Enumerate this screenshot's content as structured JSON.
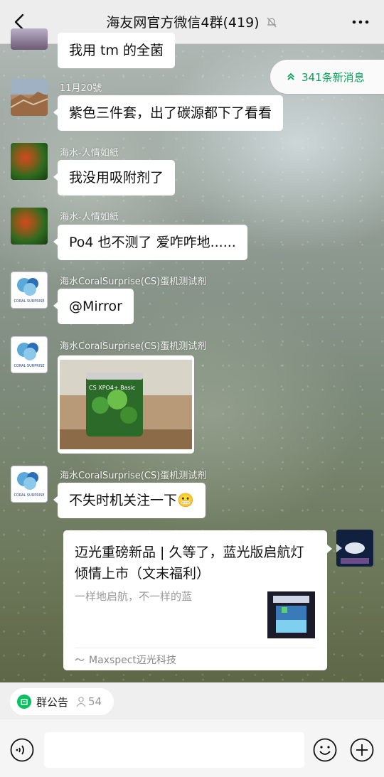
{
  "header": {
    "title": "海友网官方微信4群(419)",
    "back_icon": "chevron-left-icon",
    "mute_icon": "bell-off-icon",
    "more_icon": "more-dots-icon"
  },
  "new_messages": {
    "label": "341条新消息",
    "icon": "double-chevron-up-icon",
    "color": "#07a35a"
  },
  "messages": [
    {
      "text": "我用 tm 的全菌"
    },
    {
      "sender": "11月20號",
      "text": "紫色三件套，出了碳源都下了看看"
    },
    {
      "sender": "海水-人情如紙",
      "text": "我没用吸附剂了"
    },
    {
      "sender": "海水-人情如紙",
      "text": "Po4 也不测了  爱咋咋地......"
    },
    {
      "sender": "海水CoralSurprise(CS)蛋机测试剂",
      "text": "@Mirror"
    },
    {
      "sender": "海水CoralSurprise(CS)蛋机测试剂",
      "image_label": "CS  XPO4+ Basic"
    },
    {
      "sender": "海水CoralSurprise(CS)蛋机测试剂",
      "text": "不失时机关注一下",
      "emoji": "😬"
    }
  ],
  "avatars": {
    "cs_logo_text": "CORAL SURPRISE"
  },
  "link_card": {
    "title": "迈光重磅新品 | 久等了，蓝光版启航灯倾情上市（文末福利）",
    "subtitle": "一样地启航，不一样的蓝",
    "source": "Maxspect迈光科技"
  },
  "notice": {
    "label": "群公告",
    "members": "54",
    "icon": "notice-icon",
    "accent": "#07c160"
  },
  "input": {
    "placeholder": "",
    "voice_icon": "voice-icon",
    "emoji_icon": "emoji-icon",
    "plus_icon": "plus-icon"
  }
}
